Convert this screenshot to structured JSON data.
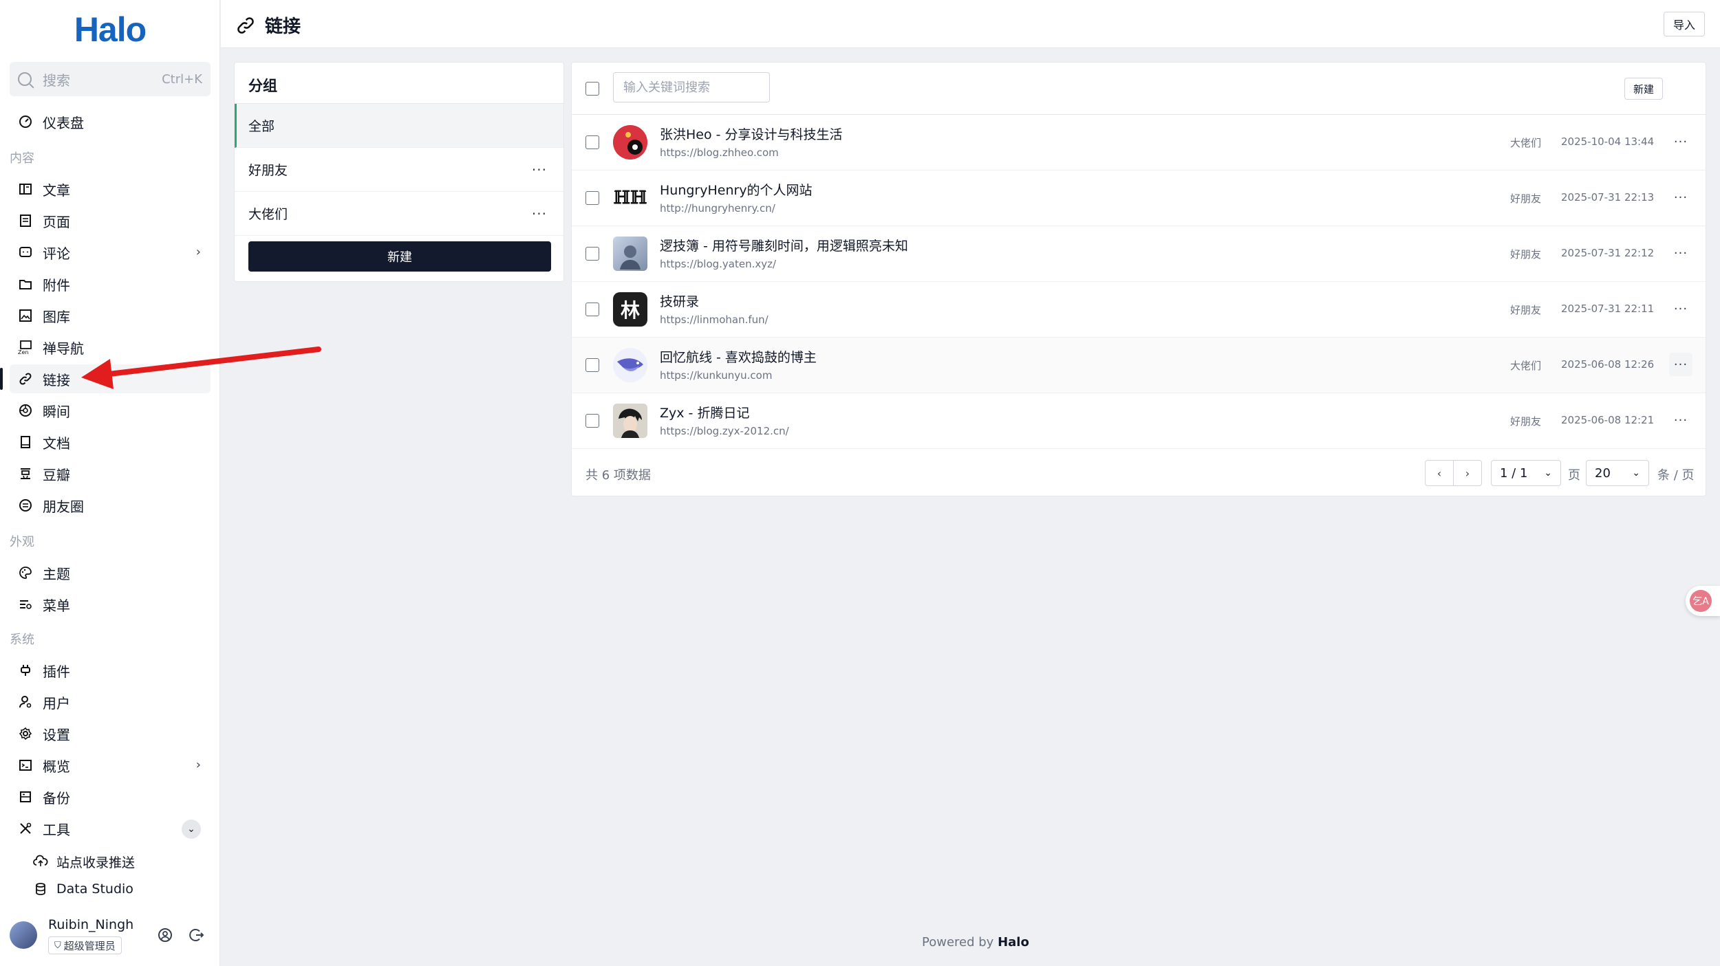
{
  "app": {
    "logo": "Halo",
    "accent": "#1565c0"
  },
  "sidebar": {
    "search": {
      "label": "搜索",
      "shortcut": "Ctrl+K"
    },
    "dashboard": "仪表盘",
    "groups": {
      "content": "内容",
      "appearance": "外观",
      "system": "系统"
    },
    "content_items": [
      {
        "label": "文章",
        "icon": "book-open-icon"
      },
      {
        "label": "页面",
        "icon": "page-icon"
      },
      {
        "label": "评论",
        "icon": "comment-icon",
        "expandable": true
      },
      {
        "label": "附件",
        "icon": "folder-icon"
      },
      {
        "label": "图库",
        "icon": "image-icon"
      },
      {
        "label": "禅导航",
        "icon": "nav-icon"
      },
      {
        "label": "链接",
        "icon": "link-icon",
        "active": true
      },
      {
        "label": "瞬间",
        "icon": "moments-icon"
      },
      {
        "label": "文档",
        "icon": "doc-icon"
      },
      {
        "label": "豆瓣",
        "icon": "douban-icon"
      },
      {
        "label": "朋友圈",
        "icon": "friends-icon"
      }
    ],
    "appearance_items": [
      {
        "label": "主题",
        "icon": "palette-icon"
      },
      {
        "label": "菜单",
        "icon": "menu-icon"
      }
    ],
    "system_items": [
      {
        "label": "插件",
        "icon": "plug-icon"
      },
      {
        "label": "用户",
        "icon": "user-icon"
      },
      {
        "label": "设置",
        "icon": "gear-icon"
      },
      {
        "label": "概览",
        "icon": "terminal-icon",
        "expandable": true
      },
      {
        "label": "备份",
        "icon": "backup-icon"
      },
      {
        "label": "工具",
        "icon": "tools-icon",
        "expanded": true
      }
    ],
    "tool_sub_items": [
      {
        "label": "站点收录推送",
        "icon": "cloud-upload-icon"
      },
      {
        "label": "Data Studio",
        "icon": "database-icon"
      }
    ],
    "user": {
      "name": "Ruibin_Ningh",
      "role": "超级管理员"
    }
  },
  "header": {
    "title": "链接",
    "import_label": "导入"
  },
  "group_panel": {
    "title": "分组",
    "groups": [
      {
        "label": "全部",
        "active": true
      },
      {
        "label": "好朋友"
      },
      {
        "label": "大佬们"
      }
    ],
    "new_label": "新建"
  },
  "links_panel": {
    "search_placeholder": "输入关键词搜索",
    "new_label": "新建",
    "rows": [
      {
        "name": "张洪Heo - 分享设计与科技生活",
        "url": "https://blog.zhheo.com",
        "group": "大佬们",
        "date": "2025-10-04 13:44"
      },
      {
        "name": "HungryHenry的个人网站",
        "url": "http://hungryhenry.cn/",
        "group": "好朋友",
        "date": "2025-07-31 22:13",
        "avatar_text": "ℍℍ"
      },
      {
        "name": "逻技簿 - 用符号雕刻时间，用逻辑照亮未知",
        "url": "https://blog.yaten.xyz/",
        "group": "好朋友",
        "date": "2025-07-31 22:12"
      },
      {
        "name": "技研录",
        "url": "https://linmohan.fun/",
        "group": "好朋友",
        "date": "2025-07-31 22:11",
        "avatar_text": "林"
      },
      {
        "name": "回忆航线 - 喜欢捣鼓的博主",
        "url": "https://kunkunyu.com",
        "group": "大佬们",
        "date": "2025-06-08 12:26",
        "highlight": true
      },
      {
        "name": "Zyx - 折腾日记",
        "url": "https://blog.zyx-2012.cn/",
        "group": "好朋友",
        "date": "2025-06-08 12:21"
      }
    ],
    "footer": {
      "total": "共 6 项数据",
      "page": "1 / 1",
      "page_unit": "页",
      "page_size": "20",
      "size_unit": "条 / 页"
    }
  },
  "footer": {
    "powered_prefix": "Powered by ",
    "brand": "Halo"
  },
  "float_button": {
    "text": "乞A"
  }
}
